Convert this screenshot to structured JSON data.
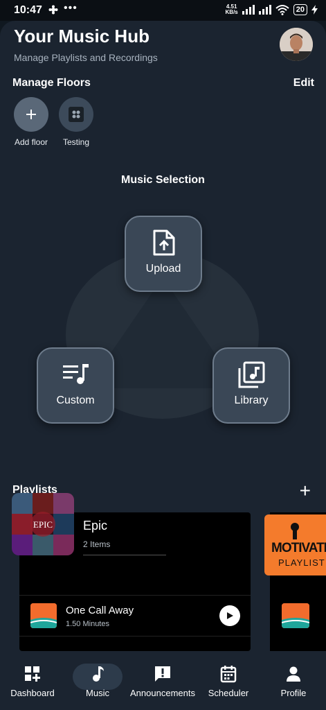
{
  "status_bar": {
    "time": "10:47",
    "dots": "•••",
    "net_speed_value": "4.51",
    "net_speed_unit": "KB/s",
    "battery": "20"
  },
  "header": {
    "title": "Your Music Hub",
    "subtitle": "Manage Playlists and Recordings"
  },
  "floors": {
    "title": "Manage Floors",
    "edit_label": "Edit",
    "items": [
      {
        "label": "Add floor"
      },
      {
        "label": "Testing"
      }
    ]
  },
  "music_selection": {
    "title": "Music Selection",
    "options": [
      {
        "label": "Upload",
        "icon": "upload-file-icon"
      },
      {
        "label": "Custom",
        "icon": "queue-music-icon"
      },
      {
        "label": "Library",
        "icon": "library-music-icon"
      }
    ]
  },
  "playlists": {
    "title": "Playlists",
    "add_label": "+",
    "items": [
      {
        "name": "Epic",
        "count": "2 Items",
        "cover_text": "EPIC",
        "tracks": [
          {
            "name": "One Call Away",
            "duration": "1.50 Minutes"
          }
        ]
      },
      {
        "cover_text_1": "MOTIVATIO",
        "cover_text_2": "PLAYLIST"
      }
    ]
  },
  "bottom_nav": {
    "active": "Music",
    "items": [
      {
        "label": "Dashboard",
        "icon": "dashboard-add-icon"
      },
      {
        "label": "Music",
        "icon": "music-note-icon"
      },
      {
        "label": "Announcements",
        "icon": "announcement-icon"
      },
      {
        "label": "Scheduler",
        "icon": "calendar-icon"
      },
      {
        "label": "Profile",
        "icon": "person-icon"
      }
    ]
  },
  "colors": {
    "background": "#1b2430",
    "button": "#3a4756",
    "accent_orange": "#f26c2d"
  }
}
